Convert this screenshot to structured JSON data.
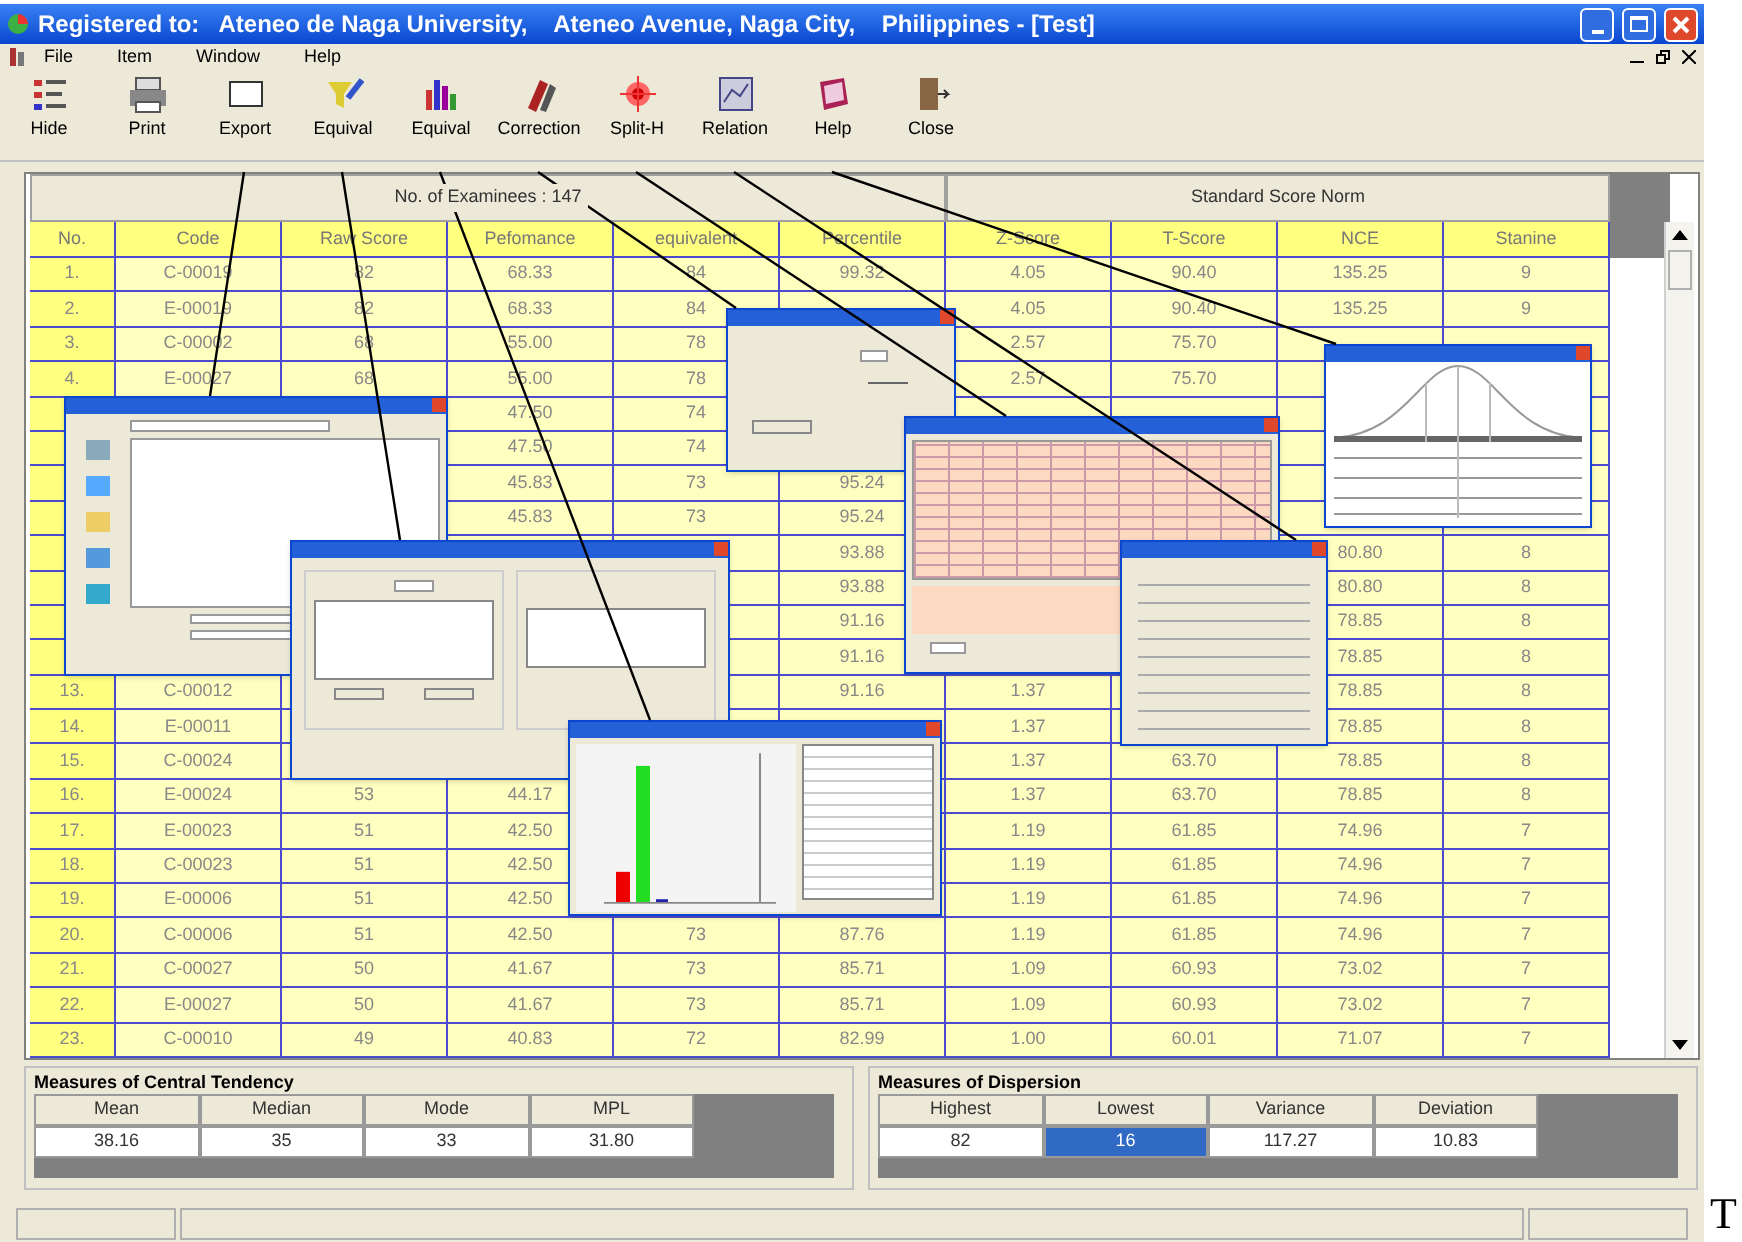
{
  "window": {
    "title": "Registered to:   Ateneo de Naga University,    Ateneo Avenue, Naga City,    Philippines - [Test]"
  },
  "menu": [
    "File",
    "Item",
    "Window",
    "Help"
  ],
  "toolbar": [
    "Hide",
    "Print",
    "Export",
    "Equival",
    "Equival",
    "Correction",
    "Split-H",
    "Relation",
    "Help",
    "Close"
  ],
  "table": {
    "group_headers": [
      "No. of Examinees : 147",
      "Standard Score Norm"
    ],
    "columns": [
      "No.",
      "Code",
      "Raw Score",
      "Pefomance",
      "equivalent",
      "Percentile",
      "Z-Score",
      "T-Score",
      "NCE",
      "Stanine"
    ],
    "rows": [
      [
        "1.",
        "C-00019",
        "82",
        "68.33",
        "84",
        "99.32",
        "4.05",
        "90.40",
        "135.25",
        "9"
      ],
      [
        "2.",
        "E-00019",
        "82",
        "68.33",
        "84",
        null,
        "4.05",
        "90.40",
        "135.25",
        "9"
      ],
      [
        "3.",
        "C-00002",
        "68",
        "55.00",
        "78",
        null,
        "2.57",
        "75.70",
        null,
        null
      ],
      [
        "4.",
        "E-00027",
        "68",
        "55.00",
        "78",
        null,
        "2.57",
        "75.70",
        null,
        null
      ],
      [
        null,
        null,
        null,
        "47.50",
        "74",
        null,
        null,
        null,
        null,
        null
      ],
      [
        null,
        null,
        null,
        "47.50",
        "74",
        null,
        null,
        null,
        null,
        null
      ],
      [
        null,
        null,
        null,
        "45.83",
        "73",
        "95.24",
        null,
        null,
        null,
        null
      ],
      [
        null,
        null,
        null,
        "45.83",
        "73",
        "95.24",
        null,
        null,
        null,
        null
      ],
      [
        null,
        null,
        null,
        null,
        null,
        "93.88",
        null,
        null,
        "80.80",
        "8"
      ],
      [
        null,
        null,
        null,
        null,
        null,
        "93.88",
        null,
        null,
        "80.80",
        "8"
      ],
      [
        null,
        null,
        null,
        null,
        null,
        "91.16",
        null,
        null,
        "78.85",
        "8"
      ],
      [
        null,
        null,
        null,
        null,
        null,
        "91.16",
        null,
        null,
        "78.85",
        "8"
      ],
      [
        "13.",
        "C-00012",
        null,
        null,
        null,
        "91.16",
        "1.37",
        null,
        "78.85",
        "8"
      ],
      [
        "14.",
        "E-00011",
        null,
        null,
        null,
        null,
        "1.37",
        null,
        "78.85",
        "8"
      ],
      [
        "15.",
        "C-00024",
        null,
        null,
        null,
        null,
        "1.37",
        "63.70",
        "78.85",
        "8"
      ],
      [
        "16.",
        "E-00024",
        "53",
        "44.17",
        null,
        null,
        "1.37",
        "63.70",
        "78.85",
        "8"
      ],
      [
        "17.",
        "E-00023",
        "51",
        "42.50",
        null,
        null,
        "1.19",
        "61.85",
        "74.96",
        "7"
      ],
      [
        "18.",
        "C-00023",
        "51",
        "42.50",
        null,
        null,
        "1.19",
        "61.85",
        "74.96",
        "7"
      ],
      [
        "19.",
        "E-00006",
        "51",
        "42.50",
        null,
        null,
        "1.19",
        "61.85",
        "74.96",
        "7"
      ],
      [
        "20.",
        "C-00006",
        "51",
        "42.50",
        "73",
        "87.76",
        "1.19",
        "61.85",
        "74.96",
        "7"
      ],
      [
        "21.",
        "C-00027",
        "50",
        "41.67",
        "73",
        "85.71",
        "1.09",
        "60.93",
        "73.02",
        "7"
      ],
      [
        "22.",
        "E-00027",
        "50",
        "41.67",
        "73",
        "85.71",
        "1.09",
        "60.93",
        "73.02",
        "7"
      ],
      [
        "23.",
        "C-00010",
        "49",
        "40.83",
        "72",
        "82.99",
        "1.00",
        "60.01",
        "71.07",
        "7"
      ]
    ]
  },
  "measures": [
    {
      "title": "Measures of Central Tendency",
      "items": [
        {
          "label": "Mean",
          "value": "38.16",
          "selected": false
        },
        {
          "label": "Median",
          "value": "35",
          "selected": false
        },
        {
          "label": "Mode",
          "value": "33",
          "selected": false
        },
        {
          "label": "MPL",
          "value": "31.80",
          "selected": false
        }
      ]
    },
    {
      "title": "Measures of Dispersion",
      "items": [
        {
          "label": "Highest",
          "value": "82",
          "selected": false
        },
        {
          "label": "Lowest",
          "value": "16",
          "selected": true
        },
        {
          "label": "Variance",
          "value": "117.27",
          "selected": false
        },
        {
          "label": "Deviation",
          "value": "10.83",
          "selected": false
        }
      ]
    }
  ],
  "page_text": "T"
}
